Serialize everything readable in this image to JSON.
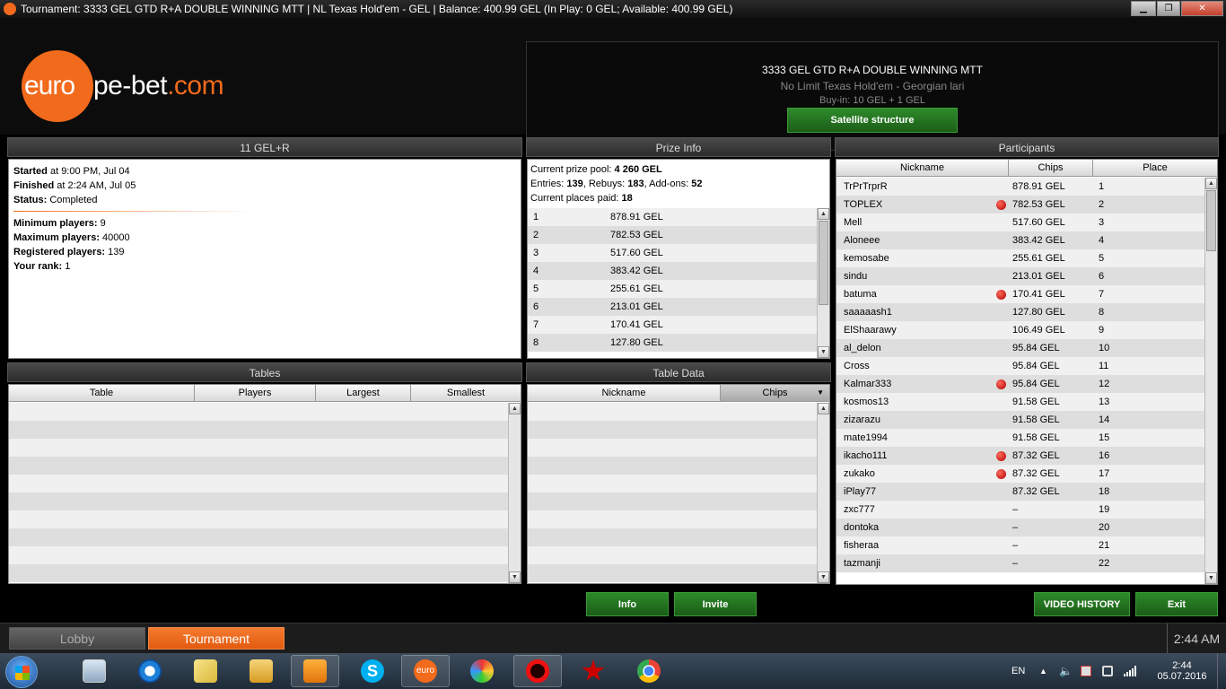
{
  "window": {
    "title": "Tournament: 3333 GEL GTD  R+A DOUBLE WINNING MTT | NL Texas Hold'em - GEL | Balance: 400.99 GEL (In Play: 0 GEL; Available: 400.99 GEL)",
    "min_glyph": "▁",
    "max_glyph": "❐",
    "close_glyph": "✕"
  },
  "logo": {
    "part1": "euro",
    "part2": "pe-bet",
    "part3": ".com"
  },
  "tournament_info": {
    "name": "3333 GEL GTD  R+A DOUBLE WINNING MTT",
    "game": "No Limit Texas Hold'em - Georgian lari",
    "buyin": "Buy-in: 10 GEL + 1 GEL",
    "satellite_button": "Satellite structure"
  },
  "details_panel": {
    "title": "11 GEL+R",
    "started_label": "Started",
    "started_value": " at 9:00 PM, Jul 04",
    "finished_label": "Finished",
    "finished_value": " at 2:24 AM, Jul 05",
    "status_label": "Status:",
    "status_value": " Completed",
    "min_label": "Minimum players:",
    "min_value": " 9",
    "max_label": "Maximum players:",
    "max_value": " 40000",
    "reg_label": "Registered players:",
    "reg_value": " 139",
    "rank_label": "Your rank:",
    "rank_value": " 1"
  },
  "prize_panel": {
    "title": "Prize Info",
    "pool_label": "Current prize pool: ",
    "pool_value": "4 260 GEL",
    "entries_label": "Entries: ",
    "entries_value": "139",
    "rebuys_label": ", Rebuys: ",
    "rebuys_value": "183",
    "addons_label": ", Add-ons: ",
    "addons_value": "52",
    "places_label": "Current places paid: ",
    "places_value": "18",
    "rows": [
      {
        "place": "1",
        "prize": "878.91 GEL"
      },
      {
        "place": "2",
        "prize": "782.53 GEL"
      },
      {
        "place": "3",
        "prize": "517.60 GEL"
      },
      {
        "place": "4",
        "prize": "383.42 GEL"
      },
      {
        "place": "5",
        "prize": "255.61 GEL"
      },
      {
        "place": "6",
        "prize": "213.01 GEL"
      },
      {
        "place": "7",
        "prize": "170.41 GEL"
      },
      {
        "place": "8",
        "prize": "127.80 GEL"
      }
    ]
  },
  "participants": {
    "title": "Participants",
    "headers": {
      "nickname": "Nickname",
      "chips": "Chips",
      "place": "Place"
    },
    "rows": [
      {
        "nick": "TrPrTrprR",
        "chips": "878.91 GEL",
        "place": "1",
        "ball": false
      },
      {
        "nick": "TOPLEX",
        "chips": "782.53 GEL",
        "place": "2",
        "ball": true
      },
      {
        "nick": "Mell",
        "chips": "517.60 GEL",
        "place": "3",
        "ball": false
      },
      {
        "nick": "Aloneee",
        "chips": "383.42 GEL",
        "place": "4",
        "ball": false
      },
      {
        "nick": "kemosabe",
        "chips": "255.61 GEL",
        "place": "5",
        "ball": false
      },
      {
        "nick": "sindu",
        "chips": "213.01 GEL",
        "place": "6",
        "ball": false
      },
      {
        "nick": "batuma",
        "chips": "170.41 GEL",
        "place": "7",
        "ball": true
      },
      {
        "nick": "saaaaash1",
        "chips": "127.80 GEL",
        "place": "8",
        "ball": false
      },
      {
        "nick": "ElShaarawy",
        "chips": "106.49 GEL",
        "place": "9",
        "ball": false
      },
      {
        "nick": "al_delon",
        "chips": "95.84 GEL",
        "place": "10",
        "ball": false
      },
      {
        "nick": "Cross",
        "chips": "95.84 GEL",
        "place": "11",
        "ball": false
      },
      {
        "nick": "Kalmar333",
        "chips": "95.84 GEL",
        "place": "12",
        "ball": true
      },
      {
        "nick": "kosmos13",
        "chips": "91.58 GEL",
        "place": "13",
        "ball": false
      },
      {
        "nick": "zizarazu",
        "chips": "91.58 GEL",
        "place": "14",
        "ball": false
      },
      {
        "nick": "mate1994",
        "chips": "91.58 GEL",
        "place": "15",
        "ball": false
      },
      {
        "nick": "ikacho111",
        "chips": "87.32 GEL",
        "place": "16",
        "ball": true
      },
      {
        "nick": "zukako",
        "chips": "87.32 GEL",
        "place": "17",
        "ball": true
      },
      {
        "nick": "iPlay77",
        "chips": "87.32 GEL",
        "place": "18",
        "ball": false
      },
      {
        "nick": "zxc777",
        "chips": "–",
        "place": "19",
        "ball": false
      },
      {
        "nick": "dontoka",
        "chips": "–",
        "place": "20",
        "ball": false
      },
      {
        "nick": "fisheraa",
        "chips": "–",
        "place": "21",
        "ball": false
      },
      {
        "nick": "tazmanji",
        "chips": "–",
        "place": "22",
        "ball": false
      }
    ]
  },
  "tables_panel": {
    "title": "Tables",
    "headers": {
      "table": "Table",
      "players": "Players",
      "largest": "Largest",
      "smallest": "Smallest"
    }
  },
  "table_data_panel": {
    "title": "Table Data",
    "headers": {
      "nickname": "Nickname",
      "chips": "Chips"
    }
  },
  "buttons": {
    "info": "Info",
    "invite": "Invite",
    "video_history": "VIDEO HISTORY",
    "exit": "Exit"
  },
  "tabs": {
    "lobby": "Lobby",
    "tournament": "Tournament",
    "clock": "2:44 AM"
  },
  "taskbar": {
    "euro_label": "euro",
    "lang": "EN",
    "time": "2:44",
    "date": "05.07.2016"
  },
  "colors": {
    "accent": "#f26a1b",
    "button_green": "#2e8a2a",
    "active_tab": "#f26a1b"
  }
}
